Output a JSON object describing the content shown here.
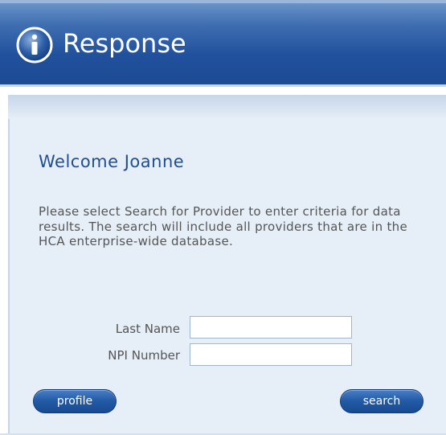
{
  "header": {
    "title": "Response"
  },
  "welcome": {
    "heading": "Welcome Joanne",
    "instructions": "Please select Search for Provider to enter criteria for data results. The search will include all providers that are in the HCA enterprise-wide database."
  },
  "form": {
    "last_name_label": "Last Name",
    "last_name_value": "",
    "npi_label": "NPI Number",
    "npi_value": ""
  },
  "buttons": {
    "profile_label": "profile",
    "search_label": "search"
  },
  "colors": {
    "header_blue": "#21519d",
    "heading_blue": "#1f4e93",
    "panel_bg": "#e6eef7",
    "button_blue": "#245ca8"
  },
  "icons": {
    "header_icon": "info-icon"
  }
}
